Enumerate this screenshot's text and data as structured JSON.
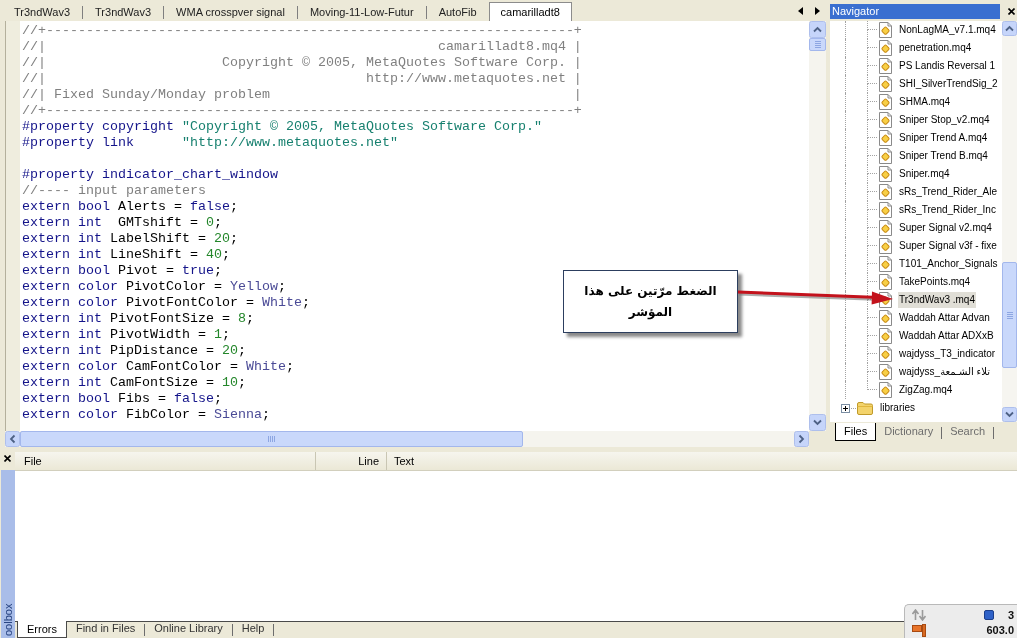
{
  "editor_tabs": [
    {
      "label": "Tr3ndWav3",
      "selected": false
    },
    {
      "label": "Tr3ndWav3",
      "selected": false
    },
    {
      "label": "WMA crosspver signal",
      "selected": false
    },
    {
      "label": "Moving-11-Low-Futur",
      "selected": false
    },
    {
      "label": "AutoFib",
      "selected": false
    },
    {
      "label": "camarilladt8",
      "selected": true
    }
  ],
  "editor": {
    "lines": [
      {
        "kind": "code",
        "tokens": [
          {
            "kind": "comment",
            "text": "//+------------------------------------------------------------------+"
          }
        ]
      },
      {
        "kind": "code",
        "tokens": [
          {
            "kind": "comment",
            "text": "//|                                                 camarilladt8.mq4 |"
          }
        ]
      },
      {
        "kind": "code",
        "tokens": [
          {
            "kind": "comment",
            "text": "//|                      Copyright © 2005, MetaQuotes Software Corp. |"
          }
        ]
      },
      {
        "kind": "code",
        "tokens": [
          {
            "kind": "comment",
            "text": "//|                                        http://www.metaquotes.net |"
          }
        ]
      },
      {
        "kind": "code",
        "tokens": [
          {
            "kind": "comment",
            "text": "//| Fixed Sunday/Monday problem                                      |"
          }
        ]
      },
      {
        "kind": "code",
        "tokens": [
          {
            "kind": "comment",
            "text": "//+------------------------------------------------------------------+"
          }
        ]
      },
      {
        "kind": "code",
        "tokens": [
          {
            "kind": "keyword",
            "text": "#property copyright "
          },
          {
            "kind": "string",
            "text": "\"Copyright © 2005, MetaQuotes Software Corp.\""
          }
        ]
      },
      {
        "kind": "code",
        "tokens": [
          {
            "kind": "keyword",
            "text": "#property link      "
          },
          {
            "kind": "string",
            "text": "\"http://www.metaquotes.net\""
          }
        ]
      },
      {
        "kind": "blank"
      },
      {
        "kind": "code",
        "tokens": [
          {
            "kind": "keyword",
            "text": "#property indicator_chart_window"
          }
        ]
      },
      {
        "kind": "code",
        "tokens": [
          {
            "kind": "comment",
            "text": "//---- input parameters"
          }
        ]
      },
      {
        "kind": "code",
        "tokens": [
          {
            "kind": "keyword",
            "text": "extern bool "
          },
          {
            "kind": "plain",
            "text": "Alerts = "
          },
          {
            "kind": "keyword",
            "text": "false"
          },
          {
            "kind": "plain",
            "text": ";"
          }
        ]
      },
      {
        "kind": "code",
        "tokens": [
          {
            "kind": "keyword",
            "text": "extern int  "
          },
          {
            "kind": "plain",
            "text": "GMTshift = "
          },
          {
            "kind": "number",
            "text": "0"
          },
          {
            "kind": "plain",
            "text": ";"
          }
        ]
      },
      {
        "kind": "code",
        "tokens": [
          {
            "kind": "keyword",
            "text": "extern int "
          },
          {
            "kind": "plain",
            "text": "LabelShift = "
          },
          {
            "kind": "number",
            "text": "20"
          },
          {
            "kind": "plain",
            "text": ";"
          }
        ]
      },
      {
        "kind": "code",
        "tokens": [
          {
            "kind": "keyword",
            "text": "extern int "
          },
          {
            "kind": "plain",
            "text": "LineShift = "
          },
          {
            "kind": "number",
            "text": "40"
          },
          {
            "kind": "plain",
            "text": ";"
          }
        ]
      },
      {
        "kind": "code",
        "tokens": [
          {
            "kind": "keyword",
            "text": "extern bool "
          },
          {
            "kind": "plain",
            "text": "Pivot = "
          },
          {
            "kind": "keyword",
            "text": "true"
          },
          {
            "kind": "plain",
            "text": ";"
          }
        ]
      },
      {
        "kind": "code",
        "tokens": [
          {
            "kind": "keyword",
            "text": "extern color "
          },
          {
            "kind": "plain",
            "text": "PivotColor = "
          },
          {
            "kind": "constant",
            "text": "Yellow"
          },
          {
            "kind": "plain",
            "text": ";"
          }
        ]
      },
      {
        "kind": "code",
        "tokens": [
          {
            "kind": "keyword",
            "text": "extern color "
          },
          {
            "kind": "plain",
            "text": "PivotFontColor = "
          },
          {
            "kind": "constant",
            "text": "White"
          },
          {
            "kind": "plain",
            "text": ";"
          }
        ]
      },
      {
        "kind": "code",
        "tokens": [
          {
            "kind": "keyword",
            "text": "extern int "
          },
          {
            "kind": "plain",
            "text": "PivotFontSize = "
          },
          {
            "kind": "number",
            "text": "8"
          },
          {
            "kind": "plain",
            "text": ";"
          }
        ]
      },
      {
        "kind": "code",
        "tokens": [
          {
            "kind": "keyword",
            "text": "extern int "
          },
          {
            "kind": "plain",
            "text": "PivotWidth = "
          },
          {
            "kind": "number",
            "text": "1"
          },
          {
            "kind": "plain",
            "text": ";"
          }
        ]
      },
      {
        "kind": "code",
        "tokens": [
          {
            "kind": "keyword",
            "text": "extern int "
          },
          {
            "kind": "plain",
            "text": "PipDistance = "
          },
          {
            "kind": "number",
            "text": "20"
          },
          {
            "kind": "plain",
            "text": ";"
          }
        ]
      },
      {
        "kind": "code",
        "tokens": [
          {
            "kind": "keyword",
            "text": "extern color "
          },
          {
            "kind": "plain",
            "text": "CamFontColor = "
          },
          {
            "kind": "constant",
            "text": "White"
          },
          {
            "kind": "plain",
            "text": ";"
          }
        ]
      },
      {
        "kind": "code",
        "tokens": [
          {
            "kind": "keyword",
            "text": "extern int "
          },
          {
            "kind": "plain",
            "text": "CamFontSize = "
          },
          {
            "kind": "number",
            "text": "10"
          },
          {
            "kind": "plain",
            "text": ";"
          }
        ]
      },
      {
        "kind": "code",
        "tokens": [
          {
            "kind": "keyword",
            "text": "extern bool "
          },
          {
            "kind": "plain",
            "text": "Fibs = "
          },
          {
            "kind": "keyword",
            "text": "false"
          },
          {
            "kind": "plain",
            "text": ";"
          }
        ]
      },
      {
        "kind": "code",
        "tokens": [
          {
            "kind": "keyword",
            "text": "extern color "
          },
          {
            "kind": "plain",
            "text": "FibColor = "
          },
          {
            "kind": "constant",
            "text": "Sienna"
          },
          {
            "kind": "plain",
            "text": ";"
          }
        ]
      }
    ]
  },
  "callout": {
    "text": "الضغط مرّتين على هذا المؤشر"
  },
  "navigator": {
    "title": "Navigator",
    "tree": [
      {
        "kind": "folder",
        "children": [
          {
            "kind": "file",
            "label": "NonLagMA_v7.1.mq4",
            "selected": false
          },
          {
            "kind": "file",
            "label": "penetration.mq4",
            "selected": false
          },
          {
            "kind": "file",
            "label": "PS Landis Reversal 1",
            "selected": false
          },
          {
            "kind": "file",
            "label": "SHI_SilverTrendSig_2",
            "selected": false
          },
          {
            "kind": "file",
            "label": "SHMA.mq4",
            "selected": false
          },
          {
            "kind": "file",
            "label": "Sniper Stop_v2.mq4",
            "selected": false
          },
          {
            "kind": "file",
            "label": "Sniper Trend A.mq4",
            "selected": false
          },
          {
            "kind": "file",
            "label": "Sniper Trend B.mq4",
            "selected": false
          },
          {
            "kind": "file",
            "label": "Sniper.mq4",
            "selected": false
          },
          {
            "kind": "file",
            "label": "sRs_Trend_Rider_Ale",
            "selected": false
          },
          {
            "kind": "file",
            "label": "sRs_Trend_Rider_Inc",
            "selected": false
          },
          {
            "kind": "file",
            "label": "Super Signal v2.mq4",
            "selected": false
          },
          {
            "kind": "file",
            "label": "Super Signal v3f - fixe",
            "selected": false
          },
          {
            "kind": "file",
            "label": "T101_Anchor_Signals",
            "selected": false
          },
          {
            "kind": "file",
            "label": "TakePoints.mq4",
            "selected": false
          },
          {
            "kind": "file",
            "label": "Tr3ndWav3 .mq4",
            "selected": true
          },
          {
            "kind": "file",
            "label": "Waddah Attar Advan",
            "selected": false
          },
          {
            "kind": "file",
            "label": "Waddah Attar ADXxB",
            "selected": false
          },
          {
            "kind": "file",
            "label": "wajdyss_T3_indicator",
            "selected": false
          },
          {
            "kind": "file",
            "label": "wajdyss_تلاء الشـمعة",
            "selected": false
          },
          {
            "kind": "file",
            "label": "ZigZag.mq4",
            "selected": false
          }
        ]
      },
      {
        "kind": "folder",
        "label": "libraries",
        "expanded": false,
        "selected": false
      }
    ],
    "tabs": [
      {
        "label": "Files",
        "selected": true
      },
      {
        "label": "Dictionary",
        "selected": false
      },
      {
        "label": "Search",
        "selected": false
      }
    ]
  },
  "toolbox": {
    "label": "oolbox",
    "columns": [
      "File",
      "Line",
      "Text"
    ],
    "tabs": [
      {
        "label": "Errors",
        "selected": true
      },
      {
        "label": "Find in Files",
        "selected": false
      },
      {
        "label": "Online Library",
        "selected": false
      },
      {
        "label": "Help",
        "selected": false
      }
    ]
  },
  "tray": {
    "count": "3",
    "reading": "603.0"
  }
}
